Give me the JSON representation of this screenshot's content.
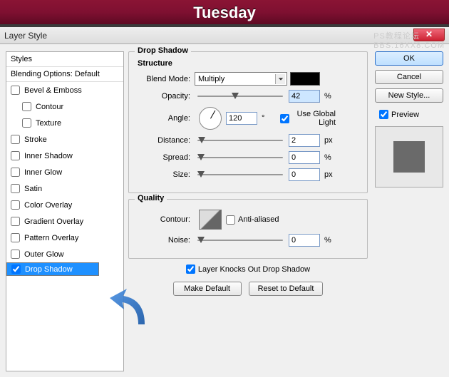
{
  "banner": {
    "day": "Tuesday"
  },
  "titlebar": {
    "title": "Layer Style"
  },
  "watermark": {
    "line1": "PS教程论坛",
    "line2": "BBS.16XX8.COM"
  },
  "sidepanel": {
    "styles_header": "Styles",
    "blending_header": "Blending Options: Default",
    "items": [
      {
        "label": "Bevel & Emboss",
        "checked": false
      },
      {
        "label": "Contour",
        "checked": false,
        "sub": true
      },
      {
        "label": "Texture",
        "checked": false,
        "sub": true
      },
      {
        "label": "Stroke",
        "checked": false
      },
      {
        "label": "Inner Shadow",
        "checked": false
      },
      {
        "label": "Inner Glow",
        "checked": false
      },
      {
        "label": "Satin",
        "checked": false
      },
      {
        "label": "Color Overlay",
        "checked": false
      },
      {
        "label": "Gradient Overlay",
        "checked": false
      },
      {
        "label": "Pattern Overlay",
        "checked": false
      },
      {
        "label": "Outer Glow",
        "checked": false
      },
      {
        "label": "Drop Shadow",
        "checked": true,
        "selected": true
      }
    ]
  },
  "main": {
    "group_title": "Drop Shadow",
    "structure_title": "Structure",
    "blend_mode_label": "Blend Mode:",
    "blend_mode_value": "Multiply",
    "swatch_color": "#000000",
    "opacity_label": "Opacity:",
    "opacity_value": "42",
    "opacity_unit": "%",
    "angle_label": "Angle:",
    "angle_value": "120",
    "angle_unit": "°",
    "global_light_label": "Use Global Light",
    "distance_label": "Distance:",
    "distance_value": "2",
    "distance_unit": "px",
    "spread_label": "Spread:",
    "spread_value": "0",
    "spread_unit": "%",
    "size_label": "Size:",
    "size_value": "0",
    "size_unit": "px",
    "quality_title": "Quality",
    "contour_label": "Contour:",
    "antialiased_label": "Anti-aliased",
    "noise_label": "Noise:",
    "noise_value": "0",
    "noise_unit": "%",
    "knocks_out_label": "Layer Knocks Out Drop Shadow",
    "make_default": "Make Default",
    "reset_default": "Reset to Default"
  },
  "rpanel": {
    "ok": "OK",
    "cancel": "Cancel",
    "new_style": "New Style...",
    "preview_label": "Preview"
  }
}
